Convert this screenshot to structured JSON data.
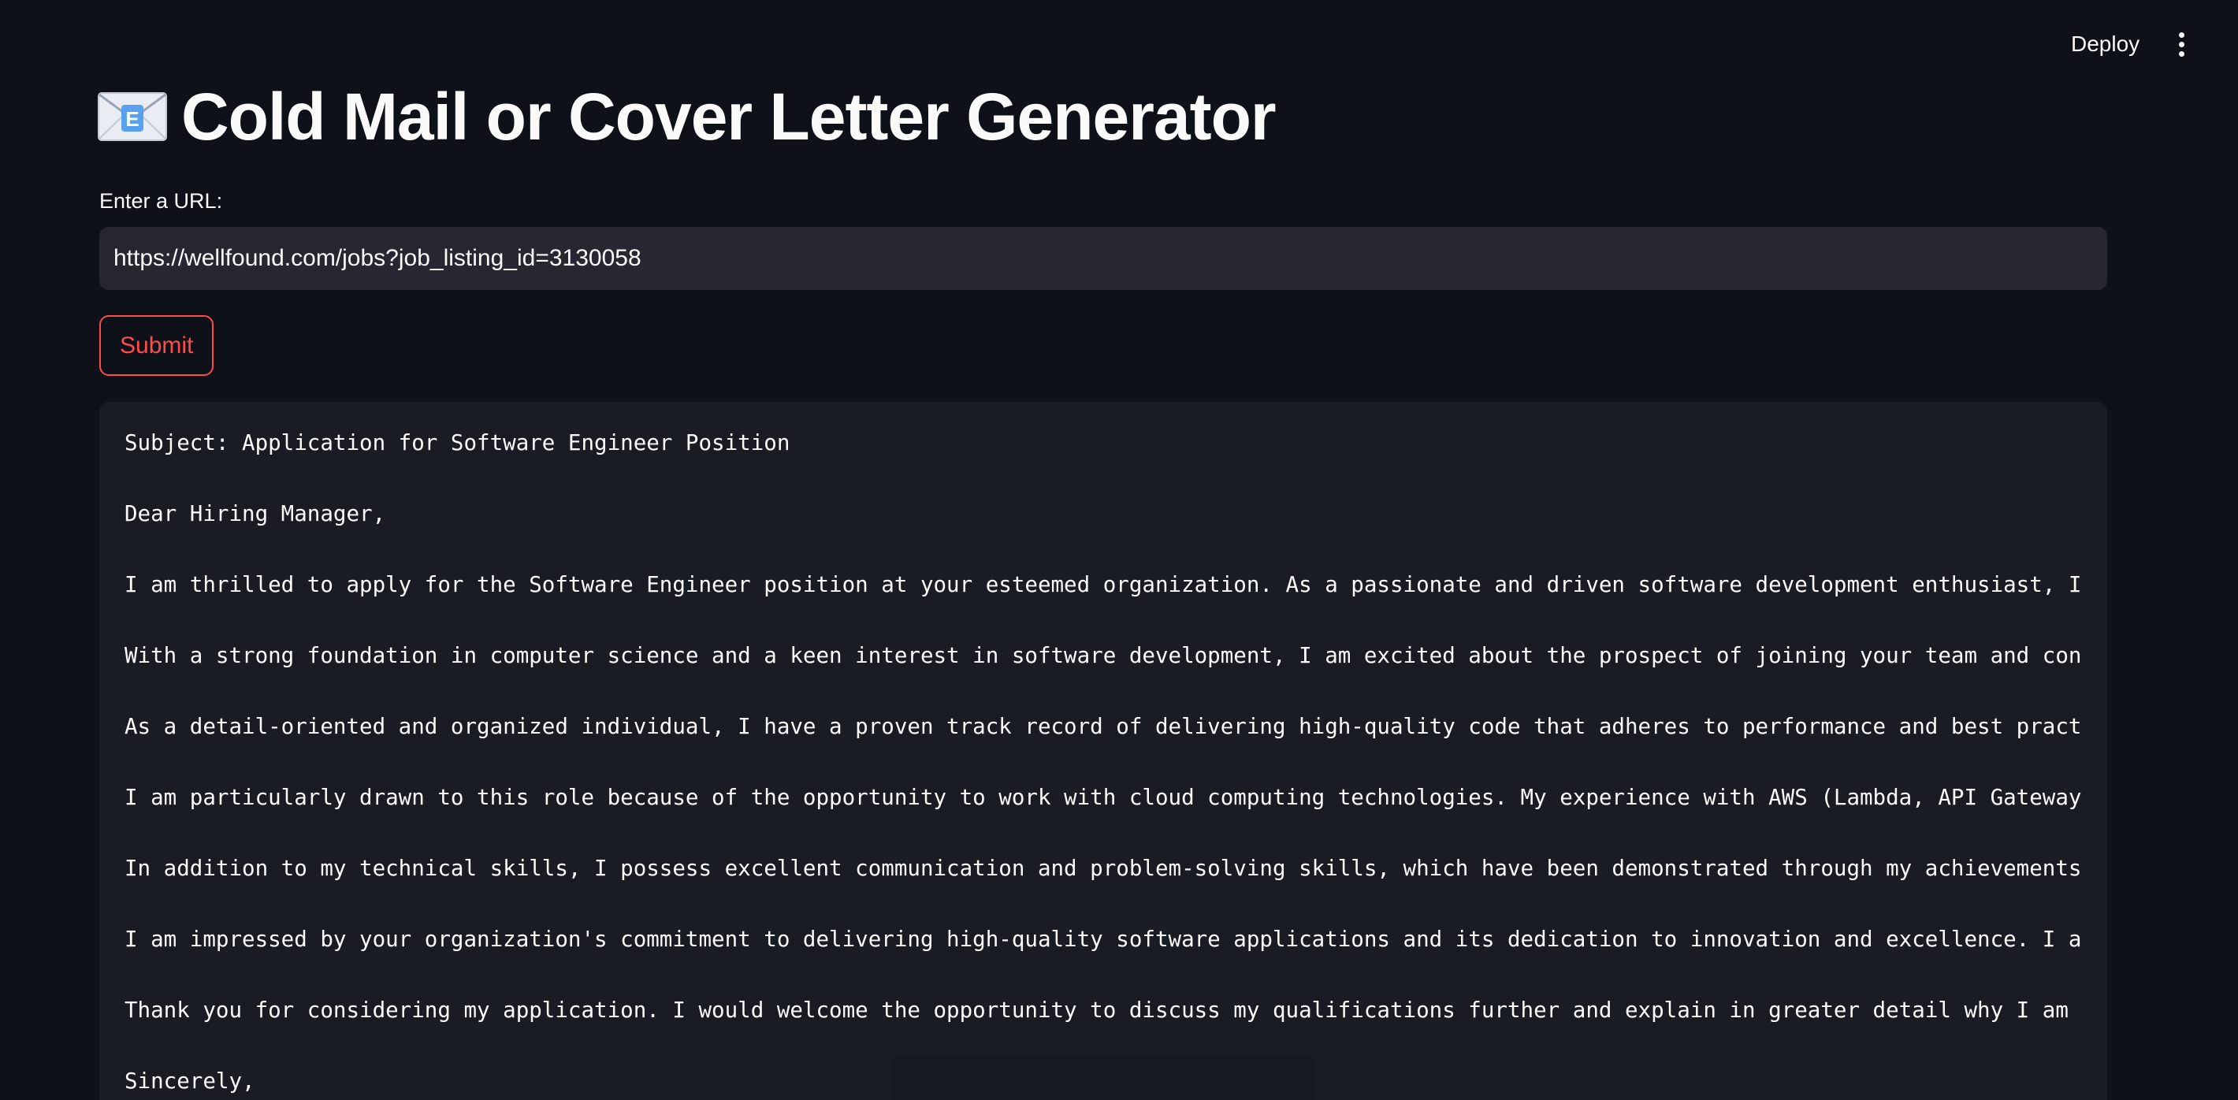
{
  "header": {
    "deploy_label": "Deploy",
    "menu_icon": "vertical-ellipsis-icon"
  },
  "main": {
    "title_icon": "envelope-icon",
    "title": "Cold Mail or Cover Letter Generator",
    "url_label": "Enter a URL:",
    "url_value": "https://wellfound.com/jobs?job_listing_id=3130058",
    "submit_label": "Submit"
  },
  "output": {
    "lines": [
      "Subject: Application for Software Engineer Position",
      "Dear Hiring Manager,",
      "I am thrilled to apply for the Software Engineer position at your esteemed organization. As a passionate and driven software development enthusiast, I",
      "With a strong foundation in computer science and a keen interest in software development, I am excited about the prospect of joining your team and con",
      "As a detail-oriented and organized individual, I have a proven track record of delivering high-quality code that adheres to performance and best pract",
      "I am particularly drawn to this role because of the opportunity to work with cloud computing technologies. My experience with AWS (Lambda, API Gateway",
      "In addition to my technical skills, I possess excellent communication and problem-solving skills, which have been demonstrated through my achievements",
      "I am impressed by your organization's commitment to delivering high-quality software applications and its dedication to innovation and excellence. I a",
      "Thank you for considering my application. I would welcome the opportunity to discuss my qualifications further and explain in greater detail why I am",
      "Sincerely,"
    ]
  },
  "colors": {
    "background": "#0e1117",
    "input_background": "#262730",
    "code_background": "#1a1c24",
    "accent": "#ff4b4b",
    "text": "#fafafa"
  }
}
